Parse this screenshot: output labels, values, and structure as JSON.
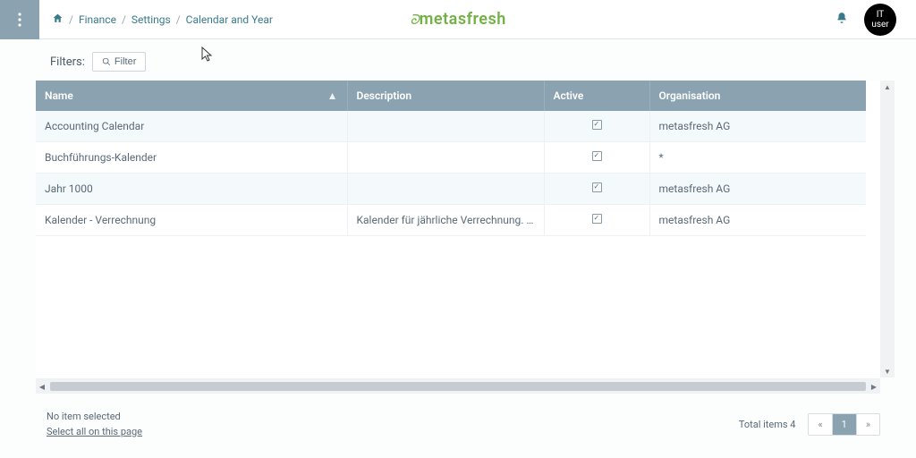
{
  "header": {
    "breadcrumb": [
      "Finance",
      "Settings",
      "Calendar and Year"
    ],
    "logo_text": "metasfresh",
    "avatar_label": "IT\nuser"
  },
  "filters": {
    "label": "Filters:",
    "button": "Filter"
  },
  "table": {
    "columns": {
      "name": "Name",
      "description": "Description",
      "active": "Active",
      "organisation": "Organisation"
    },
    "rows": [
      {
        "name": "Accounting Calendar",
        "description": "",
        "active": true,
        "organisation": "metasfresh AG"
      },
      {
        "name": "Buchführungs-Kalender",
        "description": "",
        "active": true,
        "organisation": "*"
      },
      {
        "name": "Jahr 1000",
        "description": "",
        "active": true,
        "organisation": "metasfresh AG"
      },
      {
        "name": "Kalender - Verrechnung",
        "description": "Kalender für jährliche Verrechnung. enth…",
        "active": true,
        "organisation": "metasfresh AG"
      }
    ]
  },
  "footer": {
    "no_selection": "No item selected",
    "select_all": "Select all on this page",
    "total_label": "Total items",
    "total_count": 4,
    "page": 1,
    "prev": "«",
    "next": "»"
  }
}
